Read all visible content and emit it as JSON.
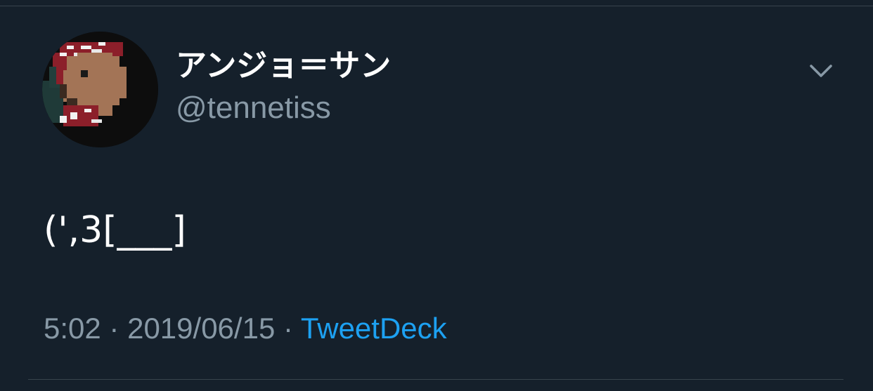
{
  "tweet": {
    "author": {
      "display_name": "アンジョ＝サン",
      "handle": "@tennetiss"
    },
    "text": "(',3[___]",
    "time": "5:02",
    "date": "2019/06/15",
    "separator": "·",
    "source": "TweetDeck",
    "menu_icon": "chevron-down-icon"
  },
  "colors": {
    "background": "#15202b",
    "primary_text": "#ffffff",
    "secondary_text": "#8899a6",
    "link": "#1da1f2",
    "divider": "#38444d"
  }
}
